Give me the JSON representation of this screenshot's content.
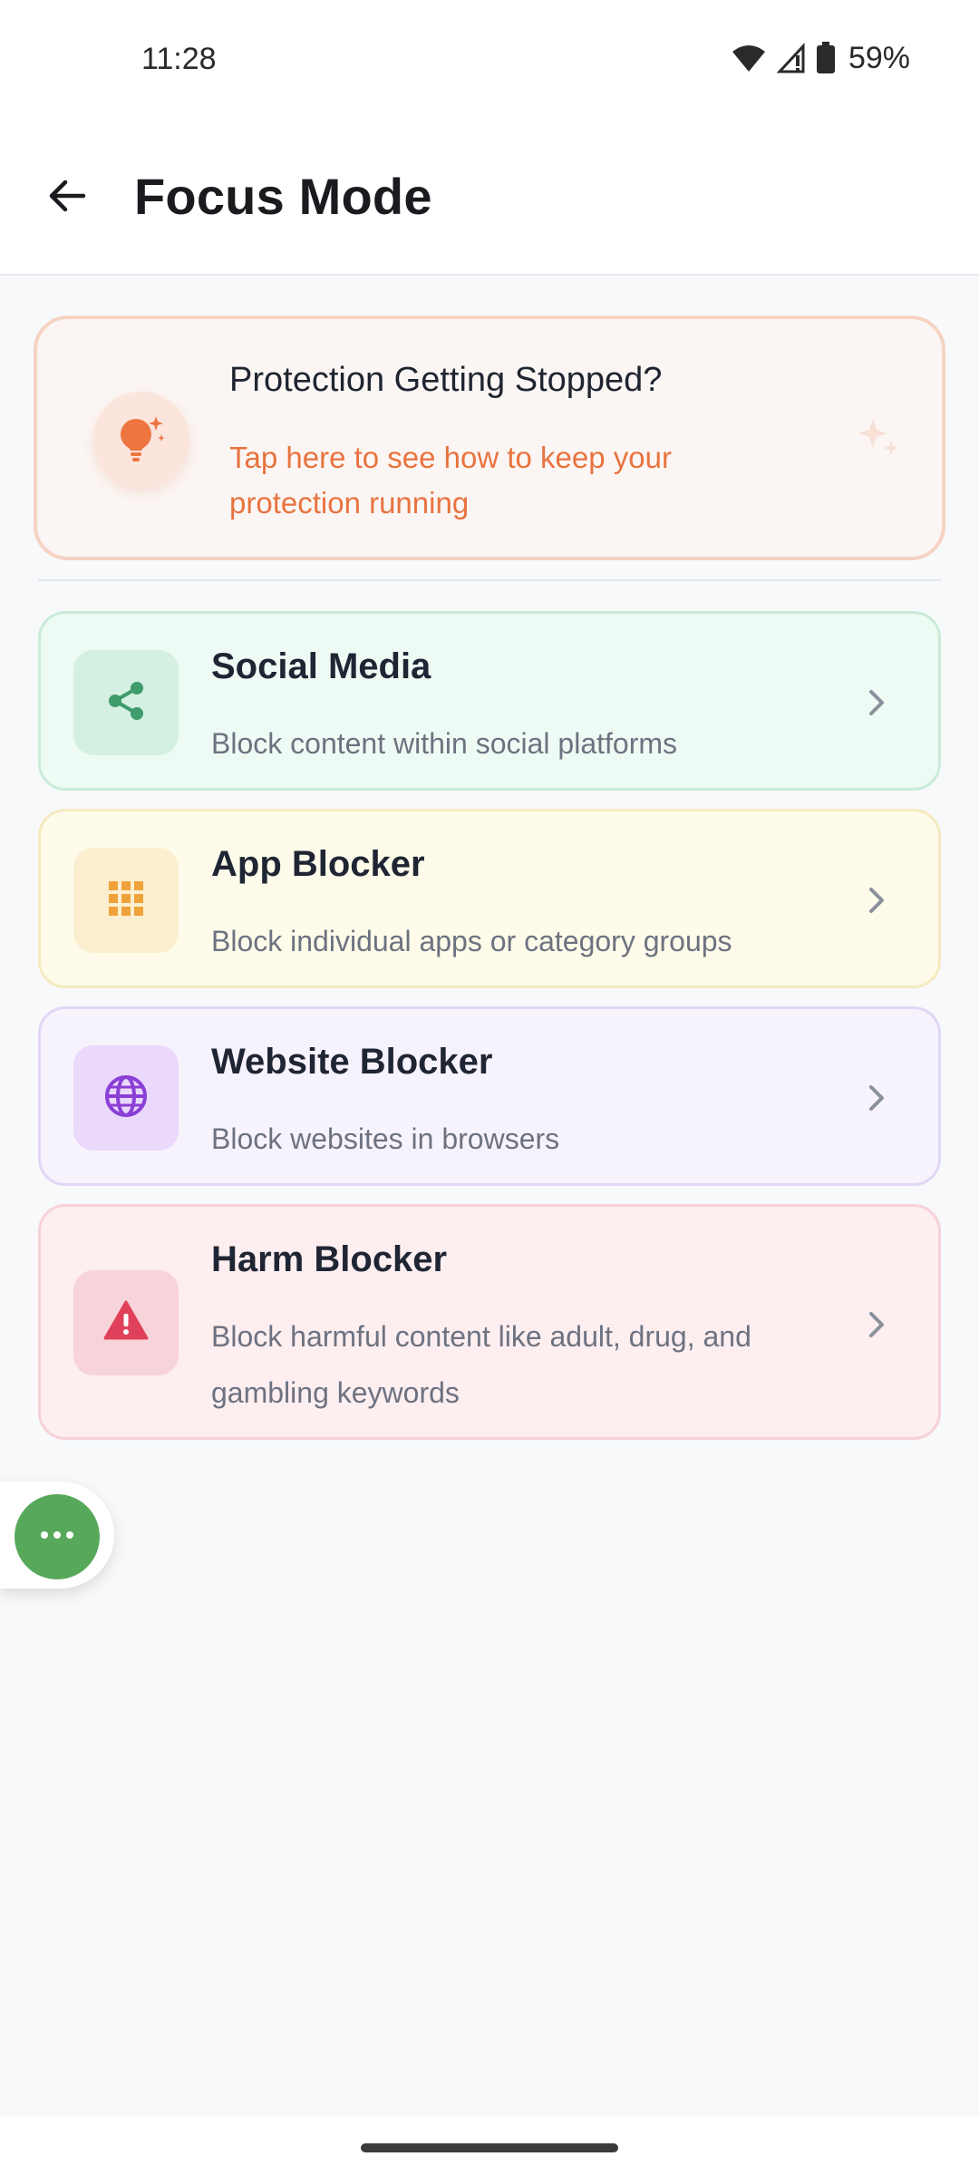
{
  "status_bar": {
    "time": "11:28",
    "battery": "59%"
  },
  "app_bar": {
    "title": "Focus Mode"
  },
  "banner": {
    "title": "Protection Getting Stopped?",
    "subtitle": "Tap here to see how to keep your protection running",
    "accent_color": "#e8733f"
  },
  "cards": [
    {
      "title": "Social Media",
      "description": "Block content within social platforms",
      "icon": "share-icon",
      "color": "#3f9b6b"
    },
    {
      "title": "App Blocker",
      "description": "Block individual apps or category groups",
      "icon": "apps-grid-icon",
      "color": "#f0a23a"
    },
    {
      "title": "Website Blocker",
      "description": "Block websites in browsers",
      "icon": "globe-icon",
      "color": "#8a3fd6"
    },
    {
      "title": "Harm Blocker",
      "description": "Block harmful content like adult, drug, and gambling keywords",
      "icon": "warning-icon",
      "color": "#e0415a"
    }
  ],
  "fab": {
    "icon": "more-dots-icon",
    "color": "#57a85a"
  }
}
